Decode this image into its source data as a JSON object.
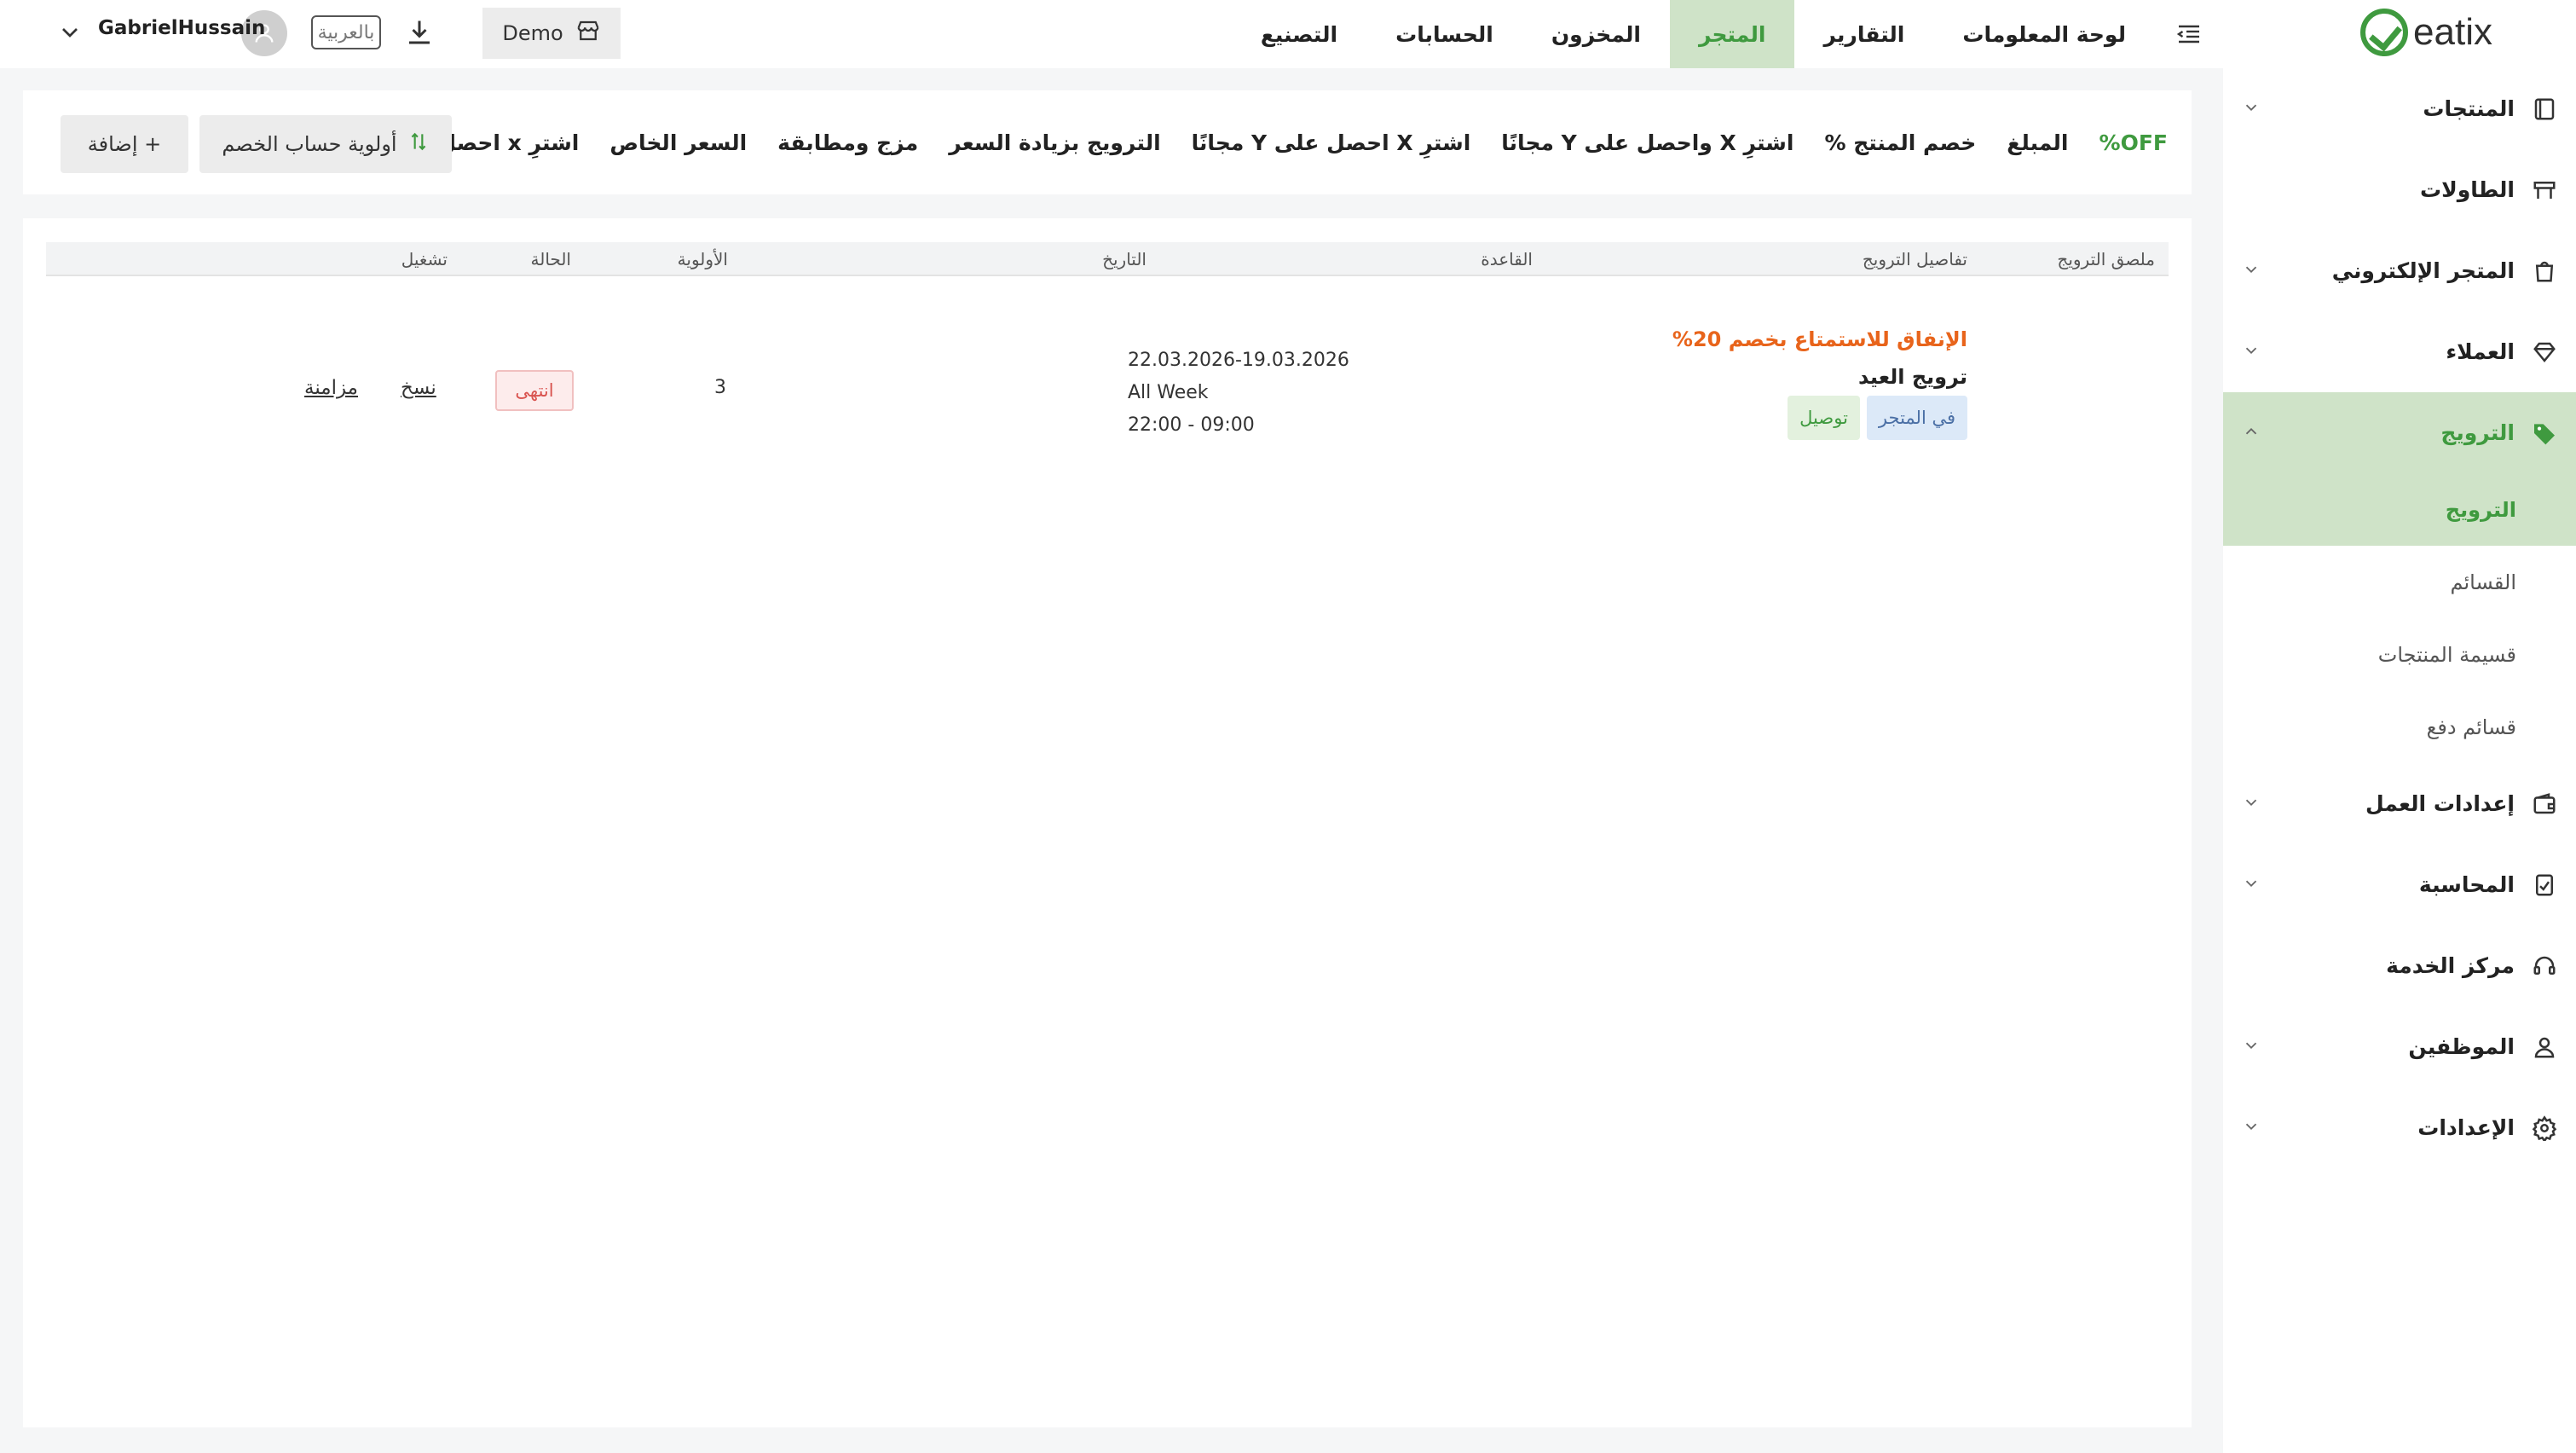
{
  "brand": {
    "name": "eatix"
  },
  "sidebar": {
    "items": [
      {
        "label": "المنتجات",
        "icon": "book-icon",
        "expandable": true
      },
      {
        "label": "الطاولات",
        "icon": "table-icon",
        "expandable": false
      },
      {
        "label": "المتجر الإلكتروني",
        "icon": "bag-icon",
        "expandable": true
      },
      {
        "label": "العملاء",
        "icon": "diamond-icon",
        "expandable": true
      },
      {
        "label": "الترويج",
        "icon": "tag-icon",
        "expandable": true,
        "active": true
      }
    ],
    "subitems": [
      {
        "label": "الترويج",
        "active": true
      },
      {
        "label": "القسائم"
      },
      {
        "label": "قسيمة المنتجات"
      },
      {
        "label": "قسائم دفع"
      }
    ],
    "items2": [
      {
        "label": "إعدادات العمل",
        "icon": "wallet-icon",
        "expandable": true
      },
      {
        "label": "المحاسبة",
        "icon": "calculator-icon",
        "expandable": true
      },
      {
        "label": "مركز الخدمة",
        "icon": "headset-icon",
        "expandable": false
      },
      {
        "label": "الموظفين",
        "icon": "person-icon",
        "expandable": true
      },
      {
        "label": "الإعدادات",
        "icon": "gear-icon",
        "expandable": true
      }
    ]
  },
  "topnav": {
    "items": [
      {
        "label": "لوحة المعلومات"
      },
      {
        "label": "التقارير"
      },
      {
        "label": "المتجر",
        "active": true
      },
      {
        "label": "المخزون"
      },
      {
        "label": "الحسابات"
      },
      {
        "label": "التصنيع"
      }
    ],
    "demo_label": "Demo",
    "lang_label": "بالعربية",
    "username": "GabrielHussain"
  },
  "filters": {
    "items": [
      "OFF%",
      "المبلغ",
      "خصم المنتج %",
      "اشترِ X واحصل على Y مجانًا",
      "اشترِ X احصل على Y مجانًا",
      "الترويج بزيادة السعر",
      "مزج ومطابقة",
      "السعر الخاص",
      "اشترِ x احصل على هدية"
    ],
    "priority_button": "أولوية حساب الخصم",
    "add_button": "+ إضافة"
  },
  "table": {
    "headers": {
      "label": "ملصق الترويج",
      "details": "تفاصيل الترويج",
      "rule": "القاعدة",
      "date": "التاريخ",
      "priority": "الأولوية",
      "status": "الحالة",
      "run": "تشغيل"
    },
    "rows": [
      {
        "name": "الإنفاق للاستمتاع بخصم 20%",
        "title": "ترويج العيد",
        "chips": [
          "في المتجر",
          "توصيل"
        ],
        "date_range": "22.03.2026-19.03.2026",
        "days": "All Week",
        "hours": "22:00 - 09:00",
        "priority": "3",
        "status": "انتهى",
        "actions": [
          "نسخ",
          "مزامنة"
        ]
      }
    ]
  }
}
